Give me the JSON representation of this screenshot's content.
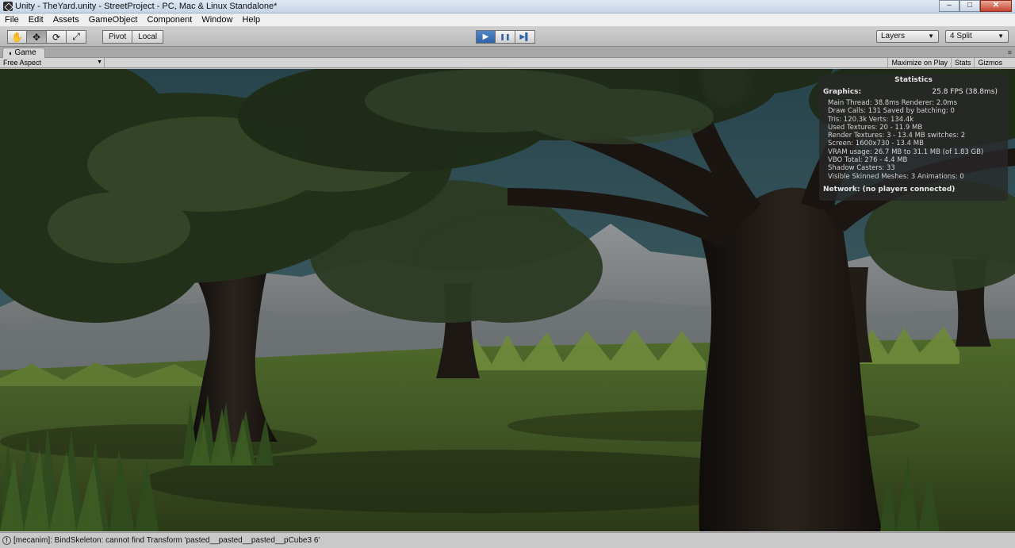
{
  "window": {
    "title": "Unity - TheYard.unity - StreetProject - PC, Mac & Linux Standalone*",
    "minimize": "–",
    "maximize": "□",
    "close": "✕"
  },
  "menu": {
    "items": [
      "File",
      "Edit",
      "Assets",
      "GameObject",
      "Component",
      "Window",
      "Help"
    ]
  },
  "toolbar": {
    "pivot_label": "Pivot",
    "local_label": "Local",
    "layers_label": "Layers",
    "layout_label": "4 Split",
    "hand_glyph": "✋",
    "move_glyph": "✥",
    "rotate_glyph": "⟳",
    "scale_glyph": "⤢",
    "play_glyph": "▶",
    "pause_glyph": "❚❚",
    "step_glyph": "▶▌"
  },
  "game_tab": {
    "label": "Game",
    "icon_glyph": "◖",
    "aspect_label": "Free Aspect",
    "maximize_label": "Maximize on Play",
    "stats_label": "Stats",
    "gizmos_label": "Gizmos"
  },
  "stats": {
    "title": "Statistics",
    "graphics_label": "Graphics:",
    "fps": "25.8 FPS (38.8ms)",
    "lines": [
      "Main Thread: 38.8ms  Renderer: 2.0ms",
      "Draw Calls: 131   Saved by batching: 0",
      "Tris: 120.3k    Verts: 134.4k",
      "Used Textures: 20 - 11.9 MB",
      "Render Textures: 3 - 13.4 MB      switches: 2",
      "Screen: 1600x730 - 13.4 MB",
      "VRAM usage: 26.7 MB to 31.1 MB (of 1.83 GB)",
      "VBO Total: 276 - 4.4 MB",
      "Shadow Casters: 33",
      "Visible Skinned Meshes: 3      Animations: 0"
    ],
    "network": "Network: (no players connected)"
  },
  "status": {
    "message": "[mecanim]: BindSkeleton: cannot find Transform 'pasted__pasted__pasted__pCube3 6'"
  },
  "colors": {
    "play_active": "#2f63a8",
    "sky": "#2e4a52",
    "grass": "#4a5a2a",
    "bark": "#1e1914"
  }
}
